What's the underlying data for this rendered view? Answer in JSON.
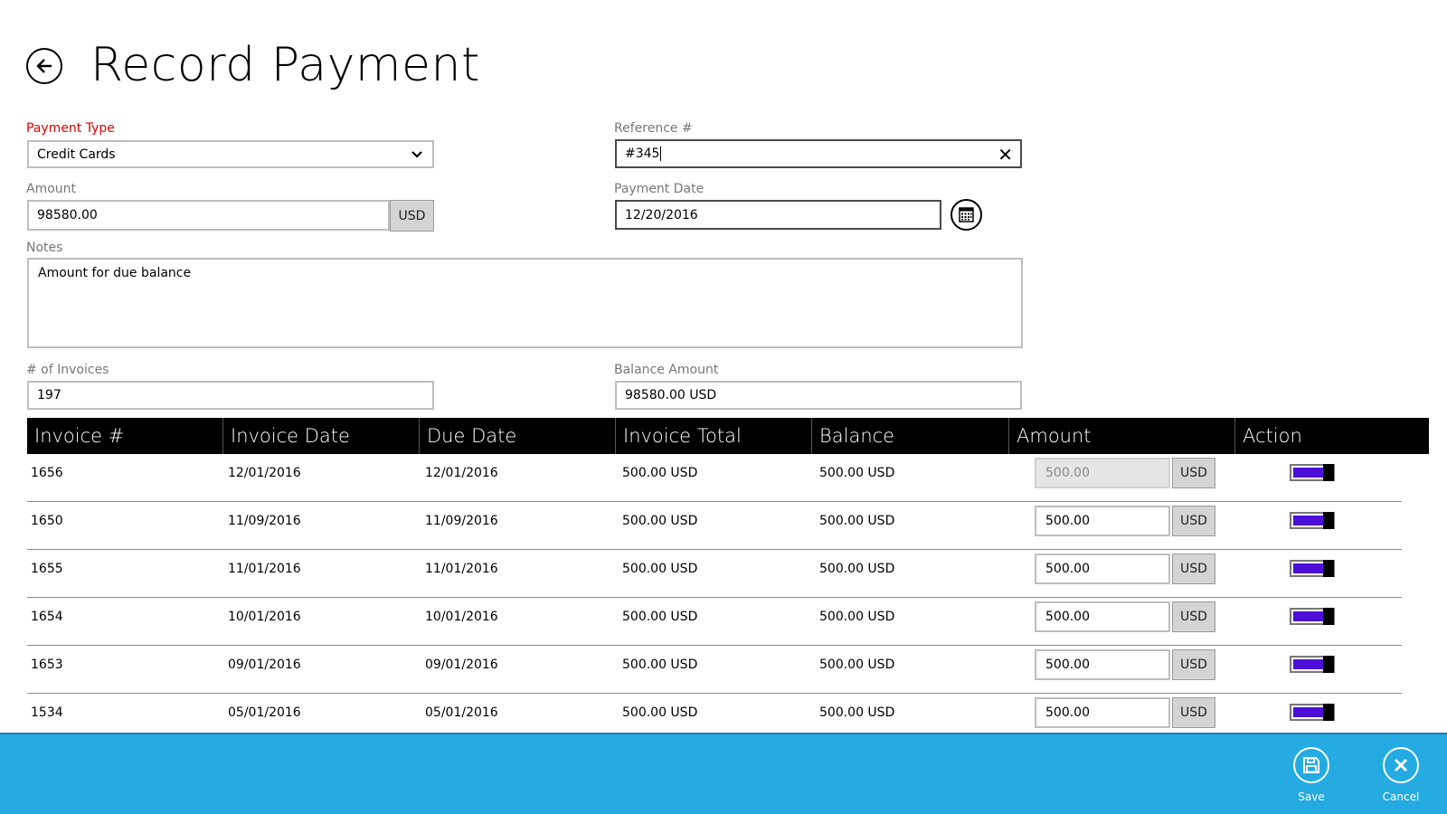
{
  "page": {
    "title": "Record Payment",
    "back_icon": "arrow-left-icon"
  },
  "form": {
    "payment_type": {
      "label": "Payment Type",
      "value": "Credit Cards"
    },
    "reference": {
      "label": "Reference #",
      "value": "#345"
    },
    "amount": {
      "label": "Amount",
      "value": "98580.00",
      "unit": "USD"
    },
    "payment_date": {
      "label": "Payment Date",
      "value": "12/20/2016"
    },
    "notes": {
      "label": "Notes",
      "value": "Amount for due balance"
    },
    "invoices_count": {
      "label": "# of Invoices",
      "value": "197"
    },
    "balance_amount": {
      "label": "Balance Amount",
      "value": "98580.00 USD"
    }
  },
  "table": {
    "columns": [
      "Invoice #",
      "Invoice Date",
      "Due Date",
      "Invoice Total",
      "Balance",
      "Amount",
      "Action"
    ],
    "rows": [
      {
        "invoice": "1656",
        "invoice_date": "12/01/2016",
        "due_date": "12/01/2016",
        "total": "500.00 USD",
        "balance": "500.00 USD",
        "amount": "500.00",
        "unit": "USD",
        "toggle_on": true,
        "amount_disabled": true
      },
      {
        "invoice": "1650",
        "invoice_date": "11/09/2016",
        "due_date": "11/09/2016",
        "total": "500.00 USD",
        "balance": "500.00 USD",
        "amount": "500.00",
        "unit": "USD",
        "toggle_on": true,
        "amount_disabled": false
      },
      {
        "invoice": "1655",
        "invoice_date": "11/01/2016",
        "due_date": "11/01/2016",
        "total": "500.00 USD",
        "balance": "500.00 USD",
        "amount": "500.00",
        "unit": "USD",
        "toggle_on": true,
        "amount_disabled": false
      },
      {
        "invoice": "1654",
        "invoice_date": "10/01/2016",
        "due_date": "10/01/2016",
        "total": "500.00 USD",
        "balance": "500.00 USD",
        "amount": "500.00",
        "unit": "USD",
        "toggle_on": true,
        "amount_disabled": false
      },
      {
        "invoice": "1653",
        "invoice_date": "09/01/2016",
        "due_date": "09/01/2016",
        "total": "500.00 USD",
        "balance": "500.00 USD",
        "amount": "500.00",
        "unit": "USD",
        "toggle_on": true,
        "amount_disabled": false
      },
      {
        "invoice": "1534",
        "invoice_date": "05/01/2016",
        "due_date": "05/01/2016",
        "total": "500.00 USD",
        "balance": "500.00 USD",
        "amount": "500.00",
        "unit": "USD",
        "toggle_on": true,
        "amount_disabled": false
      }
    ]
  },
  "app_bar": {
    "save_label": "Save",
    "cancel_label": "Cancel",
    "save_icon": "save-icon",
    "cancel_icon": "close-icon"
  },
  "colors": {
    "app_bar": "#24abe2",
    "required_label": "#e00000",
    "toggle_fill": "#4b0fd6",
    "header_bg": "#000000"
  }
}
